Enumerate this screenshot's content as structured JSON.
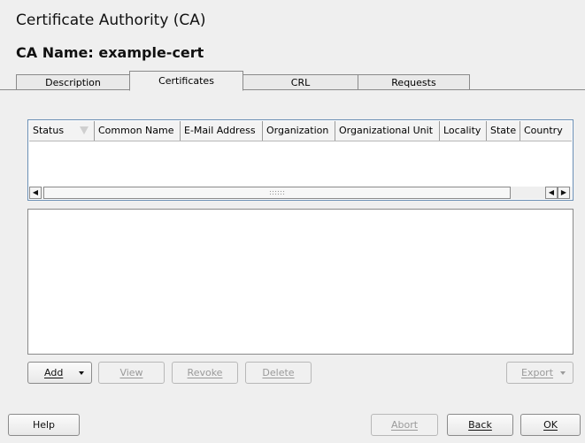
{
  "window": {
    "title": "Certificate Authority (CA)",
    "ca_name": "CA Name: example-cert"
  },
  "tabs": [
    {
      "label": "Description",
      "active": false
    },
    {
      "label": "Certificates",
      "active": true
    },
    {
      "label": "CRL",
      "active": false
    },
    {
      "label": "Requests",
      "active": false
    }
  ],
  "table": {
    "columns": [
      "Status",
      "Common Name",
      "E-Mail Address",
      "Organization",
      "Organizational Unit",
      "Locality",
      "State",
      "Country"
    ],
    "rows": [],
    "scroll_left_icon": "arrow-left-icon",
    "scroll_right_icon": "arrow-right-icon",
    "sort_icon": "sort-triangle-icon"
  },
  "actions": {
    "add": "Add",
    "view": "View",
    "revoke": "Revoke",
    "delete": "Delete",
    "export": "Export"
  },
  "footer": {
    "help": "Help",
    "abort": "Abort",
    "back": "Back",
    "ok": "OK"
  }
}
